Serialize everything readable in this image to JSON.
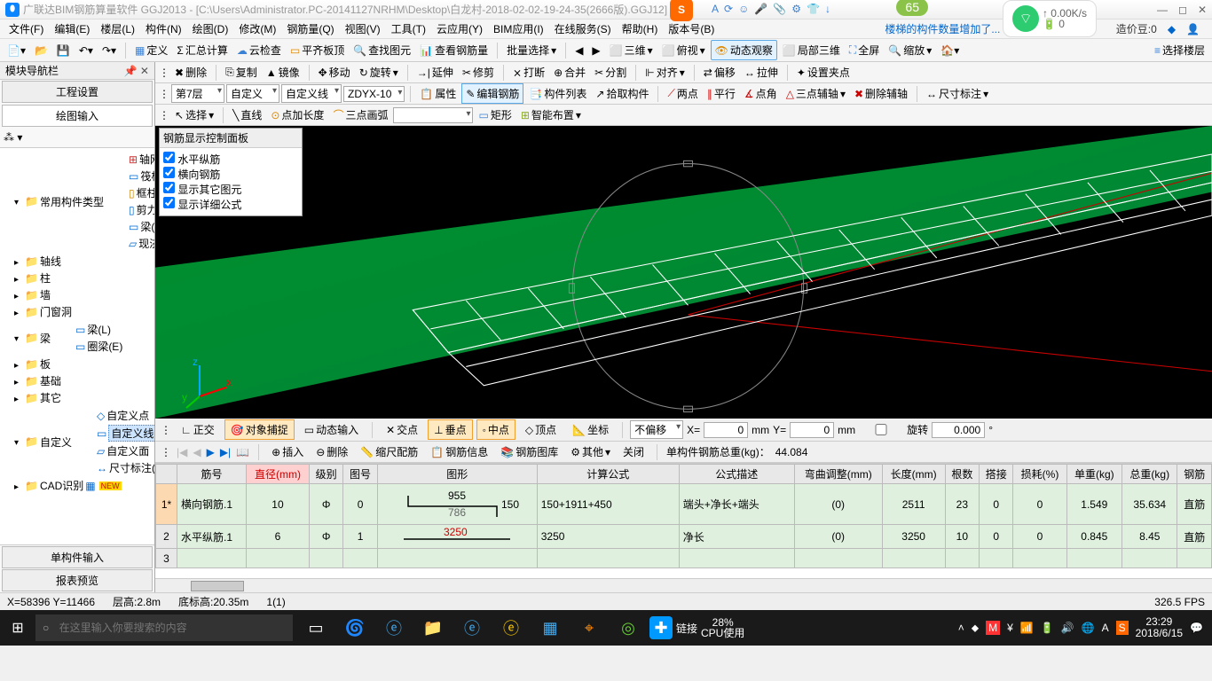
{
  "title": "广联达BIM钢筋算量软件 GGJ2013 - [C:\\Users\\Administrator.PC-20141127NRHM\\Desktop\\白龙村-2018-02-02-19-24-35(2666版).GGJ12]",
  "badge65": "65",
  "net_up": "↑ 0.00K/s",
  "net_bat": "🔋 0",
  "tip_text": "楼梯的构件数量增加了...",
  "menubar": [
    "文件(F)",
    "编辑(E)",
    "楼层(L)",
    "构件(N)",
    "绘图(D)",
    "修改(M)",
    "钢筋量(Q)",
    "视图(V)",
    "工具(T)",
    "云应用(Y)",
    "BIM应用(I)",
    "在线服务(S)",
    "帮助(H)",
    "版本号(B)"
  ],
  "zaojia": "造价豆:0",
  "tb1": {
    "define": "定义",
    "sum": "汇总计算",
    "cloud": "云检查",
    "balance": "平齐板顶",
    "find": "查找图元",
    "checkbar": "查看钢筋量",
    "batch": "批量选择",
    "three": "三维",
    "top": "俯视",
    "dyn": "动态观察",
    "local": "局部三维",
    "full": "全屏",
    "zoom": "缩放",
    "choosefloor": "选择楼层"
  },
  "tb2": [
    "删除",
    "复制",
    "镜像",
    "移动",
    "旋转",
    "延伸",
    "修剪",
    "打断",
    "合并",
    "分割",
    "对齐",
    "偏移",
    "拉伸",
    "设置夹点"
  ],
  "tb3": {
    "floor": "第7层",
    "cat": "自定义",
    "subcat": "自定义线",
    "code": "ZDYX-10",
    "attr": "属性",
    "editbar": "编辑钢筋",
    "complist": "构件列表",
    "pick": "拾取构件",
    "twopt": "两点",
    "parallel": "平行",
    "ptang": "点角",
    "threeaux": "三点辅轴",
    "delaux": "删除辅轴",
    "dim": "尺寸标注"
  },
  "tb4": {
    "select": "选择",
    "line": "直线",
    "ptlen": "点加长度",
    "arc3": "三点画弧",
    "rect": "矩形",
    "smart": "智能布置"
  },
  "floatpanel": {
    "title": "钢筋显示控制面板",
    "items": [
      "水平纵筋",
      "横向钢筋",
      "显示其它图元",
      "显示详细公式"
    ]
  },
  "leftpanel": {
    "title": "模块导航栏",
    "tabs": [
      "工程设置",
      "绘图输入"
    ],
    "tree_common": "常用构件类型",
    "tree_items1": [
      "轴网(J)",
      "筏板基础(M)",
      "框柱(Z)",
      "剪力墙(Q)",
      "梁(L)",
      "现浇板(B)"
    ],
    "tree_sections": [
      "轴线",
      "柱",
      "墙",
      "门窗洞"
    ],
    "tree_liang": "梁",
    "tree_liang_items": [
      "梁(L)",
      "圈梁(E)"
    ],
    "tree_sections2": [
      "板",
      "基础",
      "其它"
    ],
    "tree_custom": "自定义",
    "tree_custom_items": [
      "自定义点",
      "自定义线(X)",
      "自定义面",
      "尺寸标注(W)"
    ],
    "tree_cad": "CAD识别",
    "bottom": [
      "单构件输入",
      "报表预览"
    ]
  },
  "snapbar": {
    "ortho": "正交",
    "osnap": "对象捕捉",
    "dyninput": "动态输入",
    "intersect": "交点",
    "perp": "垂点",
    "mid": "中点",
    "vertex": "顶点",
    "coord": "坐标",
    "nooffset": "不偏移",
    "x": "X=",
    "xval": "0",
    "mm": "mm",
    "y": "Y=",
    "yval": "0",
    "rotate": "旋转",
    "rotval": "0.000"
  },
  "navbar2": {
    "insert": "插入",
    "delete": "删除",
    "scalebar": "缩尺配筋",
    "barinfo": "钢筋信息",
    "barlib": "钢筋图库",
    "other": "其他",
    "close": "关闭",
    "total_label": "单构件钢筋总重(kg)：",
    "total_val": "44.084"
  },
  "table": {
    "headers": [
      "",
      "筋号",
      "直径(mm)",
      "级别",
      "图号",
      "图形",
      "计算公式",
      "公式描述",
      "弯曲调整(mm)",
      "长度(mm)",
      "根数",
      "搭接",
      "损耗(%)",
      "单重(kg)",
      "总重(kg)",
      "钢筋"
    ],
    "row1": {
      "idx": "1*",
      "name": "横向钢筋.1",
      "dia": "10",
      "grade": "Φ",
      "code": "0",
      "shape_top": "955",
      "shape_bot": "786",
      "shape_r": "150",
      "formula": "150+1911+450",
      "desc": "端头+净长+端头",
      "bend": "(0)",
      "len": "2511",
      "count": "23",
      "lap": "0",
      "loss": "0",
      "unit": "1.549",
      "total": "35.634",
      "type": "直筋"
    },
    "row2": {
      "idx": "2",
      "name": "水平纵筋.1",
      "dia": "6",
      "grade": "Φ",
      "code": "1",
      "shape": "3250",
      "formula": "3250",
      "desc": "净长",
      "bend": "(0)",
      "len": "3250",
      "count": "10",
      "lap": "0",
      "loss": "0",
      "unit": "0.845",
      "total": "8.45",
      "type": "直筋"
    },
    "row3": {
      "idx": "3"
    }
  },
  "status": {
    "xy": "X=58396 Y=11466",
    "floorh": "层高:2.8m",
    "baseelev": "底标高:20.35m",
    "idx": "1(1)",
    "fps": "326.5 FPS"
  },
  "taskbar": {
    "search_placeholder": "在这里输入你要搜索的内容",
    "link": "链接",
    "cpu1": "28%",
    "cpu2": "CPU使用",
    "time": "23:29",
    "date": "2018/6/15"
  }
}
